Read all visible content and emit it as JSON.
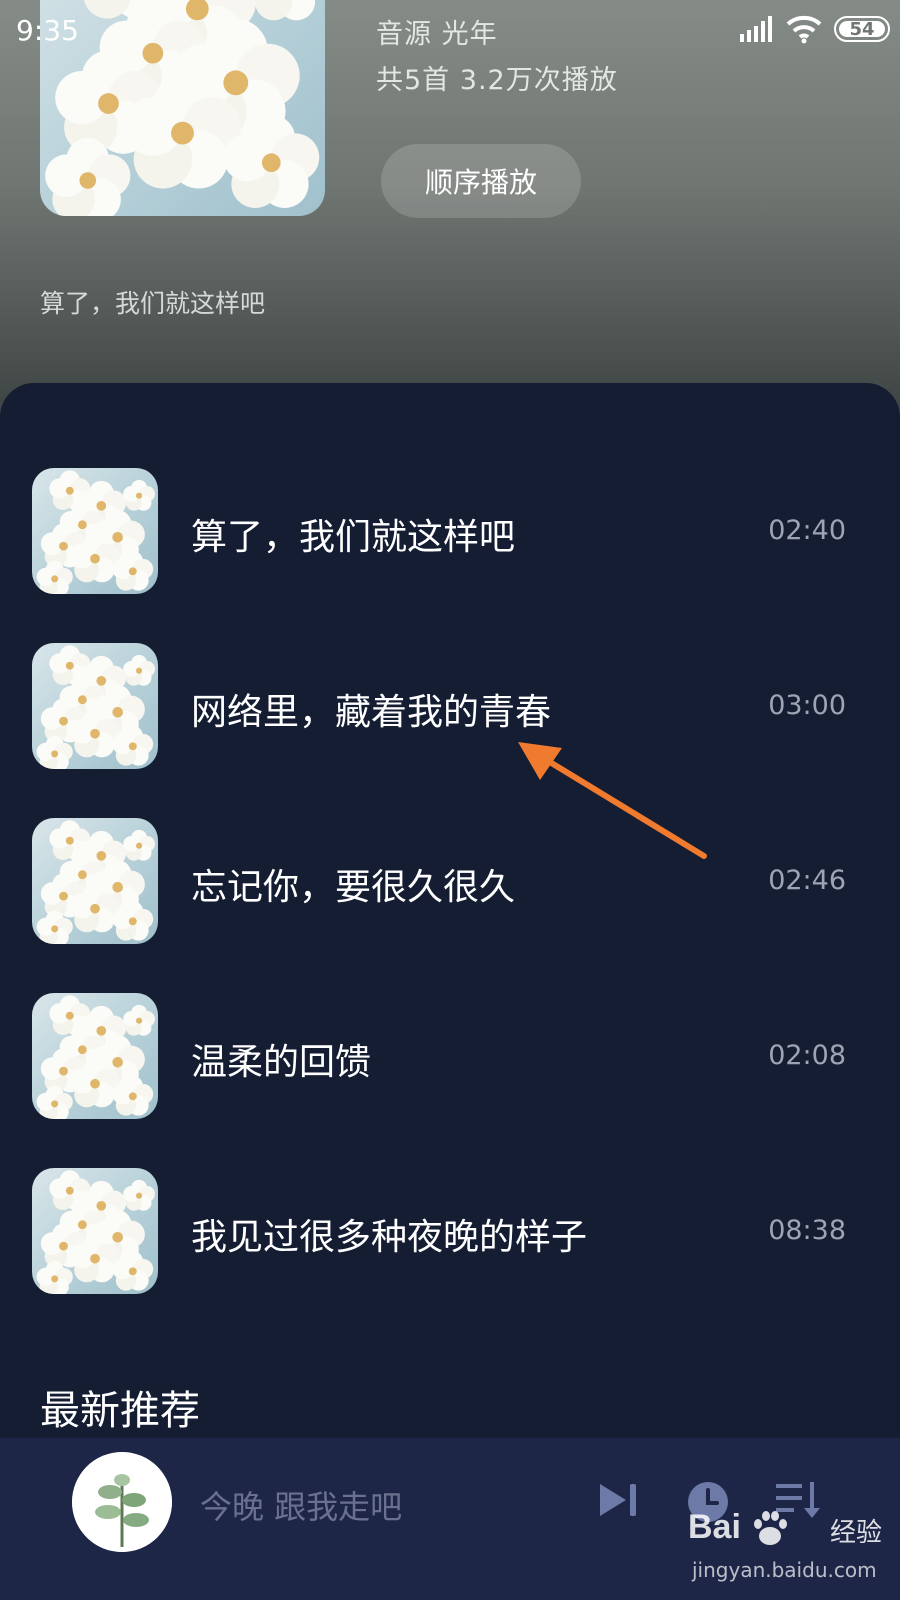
{
  "status_bar": {
    "time": "9:35",
    "battery": "54",
    "icons": [
      "signal-icon",
      "wifi-icon",
      "battery-icon"
    ]
  },
  "album": {
    "source": "音源  光年",
    "stats": "共5首  3.2万次播放",
    "play_order_label": "顺序播放",
    "subtitle": "算了，我们就这样吧"
  },
  "songs": [
    {
      "title": "算了，我们就这样吧",
      "duration": "02:40"
    },
    {
      "title": "网络里，藏着我的青春",
      "duration": "03:00"
    },
    {
      "title": "忘记你，要很久很久",
      "duration": "02:46"
    },
    {
      "title": "温柔的回馈",
      "duration": "02:08"
    },
    {
      "title": "我见过很多种夜晚的样子",
      "duration": "08:38"
    }
  ],
  "section": {
    "title": "最新推荐"
  },
  "player": {
    "now_playing": "今晚 跟我走吧",
    "icons": [
      "next-track-icon",
      "timer-icon",
      "playlist-icon"
    ]
  },
  "watermark": {
    "brand": "Bai",
    "suffix": "经验",
    "url": "jingyan.baidu.com"
  },
  "colors": {
    "panel_bg": "#151d33",
    "player_bg": "#1d2647",
    "accent_arrow": "#f07a2e",
    "duration_text": "#9ea4b4"
  }
}
